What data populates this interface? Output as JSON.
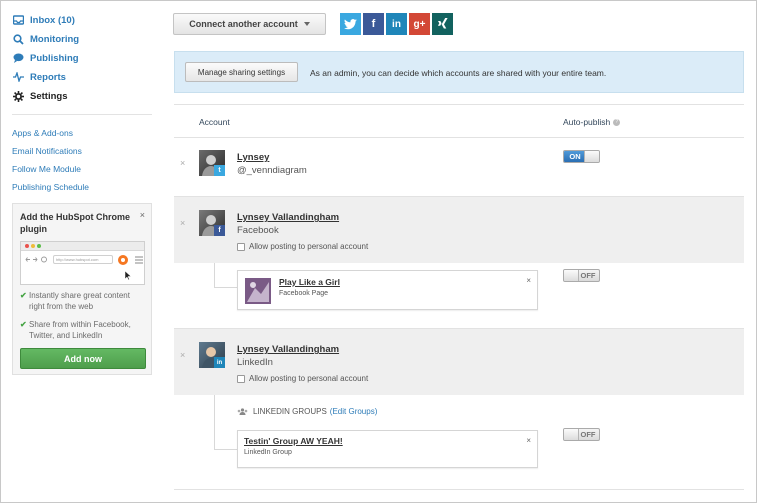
{
  "sidebar": {
    "nav": [
      {
        "label": "Inbox (10)",
        "icon": "inbox-icon"
      },
      {
        "label": "Monitoring",
        "icon": "search-icon"
      },
      {
        "label": "Publishing",
        "icon": "speech-bubble-icon"
      },
      {
        "label": "Reports",
        "icon": "activity-icon"
      },
      {
        "label": "Settings",
        "icon": "gear-icon"
      }
    ],
    "links": [
      "Apps & Add-ons",
      "Email Notifications",
      "Follow Me Module",
      "Publishing Schedule"
    ],
    "plugin": {
      "title": "Add the HubSpot Chrome plugin",
      "close": "×",
      "url_placeholder": "http://www.hubspot.com",
      "benefits": [
        "Instantly share great content right from the web",
        "Share from within Facebook, Twitter, and LinkedIn"
      ],
      "button": "Add now"
    }
  },
  "toolbar": {
    "connect_label": "Connect another account",
    "networks": [
      {
        "name": "twitter",
        "glyph": "t",
        "color": "#3aa8e0"
      },
      {
        "name": "facebook",
        "glyph": "f",
        "color": "#3b5998"
      },
      {
        "name": "linkedin",
        "glyph": "in",
        "color": "#1f86b9"
      },
      {
        "name": "google-plus",
        "glyph": "g+",
        "color": "#d34836"
      },
      {
        "name": "xing",
        "glyph": "x",
        "color": "#12625f"
      }
    ]
  },
  "banner": {
    "button": "Manage sharing settings",
    "text": "As an admin, you can decide which accounts are shared with your entire team."
  },
  "table": {
    "col_account": "Account",
    "col_autopublish": "Auto-publish",
    "accounts": [
      {
        "name": "Lynsey",
        "sub": "@_venndiagram",
        "network": "twitter",
        "toggle": "ON"
      },
      {
        "name": "Lynsey Vallandingham",
        "sub": "Facebook",
        "network": "facebook",
        "checkbox_label": "Allow posting to personal account",
        "child": {
          "title": "Play Like a Girl",
          "sub": "Facebook Page",
          "toggle": "OFF"
        }
      },
      {
        "name": "Lynsey Vallandingham",
        "sub": "LinkedIn",
        "network": "linkedin",
        "checkbox_label": "Allow posting to personal account",
        "groups_label": "LINKEDIN GROUPS",
        "groups_edit": "(Edit Groups)",
        "child": {
          "title": "Testin' Group AW YEAH!",
          "sub": "LinkedIn Group",
          "toggle": "OFF"
        }
      }
    ],
    "remove_glyph": "×"
  }
}
